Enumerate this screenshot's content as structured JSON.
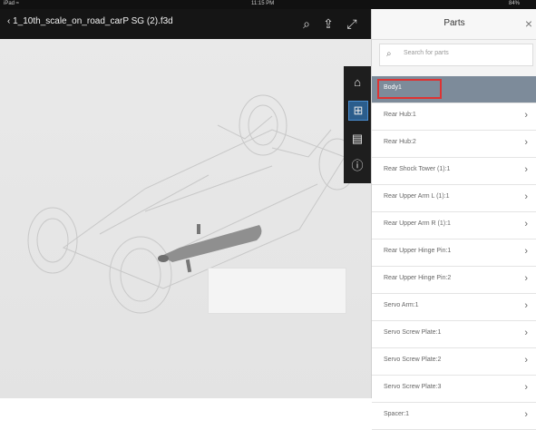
{
  "status_bar": {
    "left": "iPad ≈",
    "time": "11:15 PM",
    "battery": "84%"
  },
  "toolbar": {
    "back_label": "‹",
    "document_title": "1_10th_scale_on_road_carP SG (2).f3d",
    "icons": [
      "search-icon",
      "share-icon",
      "expand-icon"
    ]
  },
  "tools": {
    "items": [
      "home-icon",
      "parts-tree-icon",
      "properties-icon",
      "info-icon"
    ],
    "active": "parts-tree-icon"
  },
  "parts_panel": {
    "title": "Parts",
    "close_label": "×",
    "search": {
      "placeholder": "Search for parts"
    },
    "items": [
      {
        "label": "Body1",
        "selected": true
      },
      {
        "label": "Rear Hub:1"
      },
      {
        "label": "Rear Hub:2"
      },
      {
        "label": "Rear Shock Tower (1):1"
      },
      {
        "label": "Rear Upper Arm L (1):1"
      },
      {
        "label": "Rear Upper Arm R (1):1"
      },
      {
        "label": "Rear Upper Hinge Pin:1"
      },
      {
        "label": "Rear Upper Hinge Pin:2"
      },
      {
        "label": "Servo Arm:1"
      },
      {
        "label": "Servo Screw Plate:1"
      },
      {
        "label": "Servo Screw Plate:2"
      },
      {
        "label": "Servo Screw Plate:3"
      },
      {
        "label": "Spacer:1"
      }
    ]
  },
  "colors": {
    "selection": "#7d8b9a",
    "active_tool": "#2b5d8c",
    "highlight_box": "#dd3333"
  }
}
